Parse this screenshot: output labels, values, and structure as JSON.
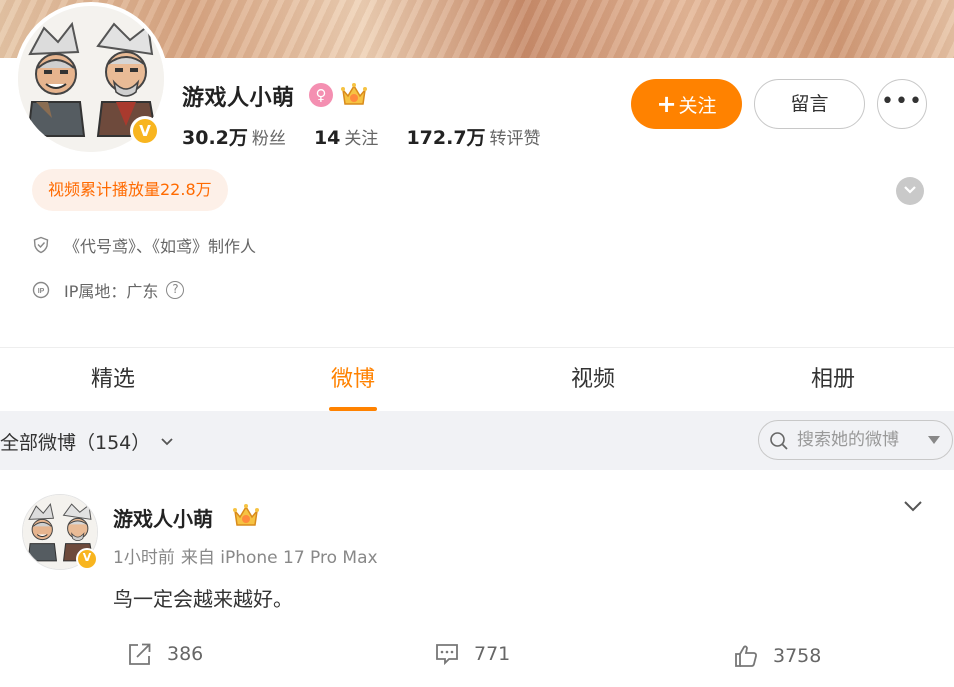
{
  "profile": {
    "name": "游戏人小萌",
    "verified_badge": "V",
    "stats": [
      {
        "num": "30.2万",
        "label": "粉丝"
      },
      {
        "num": "14",
        "label": "关注"
      },
      {
        "num": "172.7万",
        "label": "转评赞"
      }
    ],
    "follow_label": "关注",
    "follow_plus": "+",
    "message_label": "留言",
    "more_label": "•••",
    "video_plays": "视频累计播放量22.8万",
    "bio": "《代号鸢》、《如鸢》制作人",
    "ip_location": "IP属地：广东",
    "help_symbol": "?"
  },
  "tabs": [
    {
      "label": "精选",
      "active": false
    },
    {
      "label": "微博",
      "active": true
    },
    {
      "label": "视频",
      "active": false
    },
    {
      "label": "相册",
      "active": false
    }
  ],
  "filter": {
    "label": "全部微博（154）",
    "search_placeholder": "搜索她的微博"
  },
  "post": {
    "author": "游戏人小萌",
    "time": "1小时前",
    "source": "来自 iPhone 17 Pro Max",
    "text": "鸟一定会越来越好。",
    "reposts": "386",
    "comments": "771",
    "likes": "3758"
  },
  "colors": {
    "accent": "#ff8200",
    "pill_bg": "#fdf0e8",
    "pill_text": "#ff6a00",
    "verified": "#f8b51f",
    "filter_bg": "#f1f2f5"
  },
  "icons": {
    "gender": "female-icon",
    "crown": "crown-badge-icon",
    "shield": "shield-icon",
    "ip": "ip-icon",
    "search": "search-icon",
    "repost": "repost-icon",
    "comment": "comment-icon",
    "like": "thumbs-up-icon"
  }
}
